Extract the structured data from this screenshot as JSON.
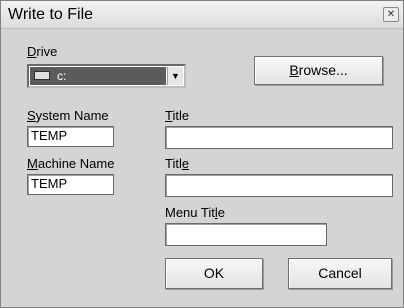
{
  "dialog": {
    "title": "Write to File",
    "close_symbol": "✕"
  },
  "drive": {
    "label_hotkey": "D",
    "label_rest": "rive",
    "selected_value": "c:",
    "dropdown_symbol": "▼"
  },
  "browse_button": {
    "hotkey": "B",
    "rest": "rowse..."
  },
  "system_name": {
    "label_hotkey": "S",
    "label_rest": "ystem Name",
    "value": "TEMP"
  },
  "machine_name": {
    "label_hotkey": "M",
    "label_rest": "achine Name",
    "value": "TEMP"
  },
  "title1": {
    "label_hotkey": "T",
    "label_rest": "itle",
    "value": ""
  },
  "title2": {
    "label_before": "Titl",
    "label_hotkey": "e",
    "value": ""
  },
  "menu_title": {
    "label_before": "Menu Tit",
    "label_hotkey": "l",
    "label_after": "e",
    "value": ""
  },
  "ok_label": "OK",
  "cancel_label": "Cancel",
  "icons": {
    "drive": "drive-icon",
    "close": "close-icon",
    "dropdown": "chevron-down-icon"
  }
}
